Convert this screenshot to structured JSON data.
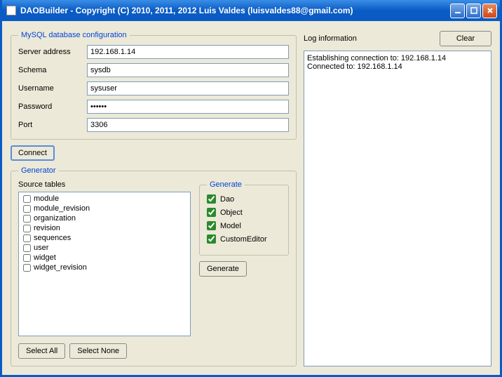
{
  "window": {
    "title": "DAOBuilder - Copyright (C) 2010, 2011, 2012  Luis Valdes (luisvaldes88@gmail.com)"
  },
  "dbConfig": {
    "legend": "MySQL database configuration",
    "serverLabel": "Server address",
    "serverValue": "192.168.1.14",
    "schemaLabel": "Schema",
    "schemaValue": "sysdb",
    "usernameLabel": "Username",
    "usernameValue": "sysuser",
    "passwordLabel": "Password",
    "passwordValue": "••••••",
    "portLabel": "Port",
    "portValue": "3306"
  },
  "connectLabel": "Connect",
  "generator": {
    "legend": "Generator",
    "sourceLabel": "Source tables",
    "tables": [
      "module",
      "module_revision",
      "organization",
      "revision",
      "sequences",
      "user",
      "widget",
      "widget_revision"
    ],
    "selectAll": "Select All",
    "selectNone": "Select None",
    "generateLegend": "Generate",
    "optDao": "Dao",
    "optObject": "Object",
    "optModel": "Model",
    "optCustomEditor": "CustomEditor",
    "generateBtn": "Generate"
  },
  "log": {
    "label": "Log information",
    "clearBtn": "Clear",
    "lines": [
      "Establishing connection to: 192.168.1.14",
      "Connected to: 192.168.1.14"
    ]
  }
}
